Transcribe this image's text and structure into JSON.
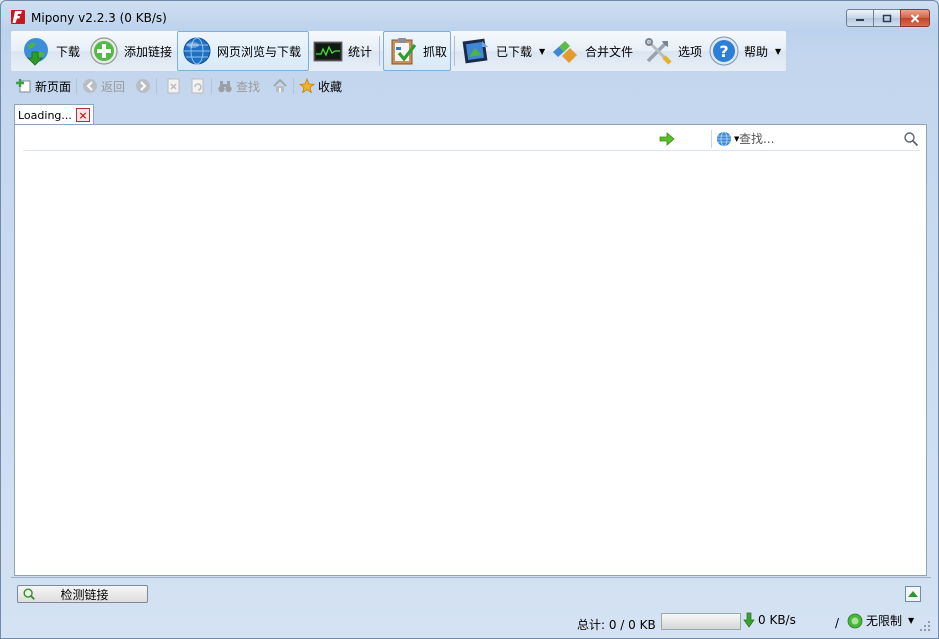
{
  "window": {
    "title": "Mipony v2.2.3 (0 KB/s)"
  },
  "toolbar": {
    "download": "下载",
    "add_link": "添加链接",
    "web_browse": "网页浏览与下载",
    "stats": "统计",
    "capture": "抓取",
    "downloaded": "已下载",
    "merge_files": "合并文件",
    "options": "选项",
    "help": "帮助"
  },
  "browserbar": {
    "new_page": "新页面",
    "back": "返回",
    "find": "查找",
    "favorites": "收藏"
  },
  "tab": {
    "label": "Loading..."
  },
  "address": {
    "value": "",
    "search_placeholder": "查找..."
  },
  "bottom": {
    "detect_links": "检测链接"
  },
  "status": {
    "total": "总计: 0 / 0 KB",
    "progress": 0,
    "speed": "0 KB/s",
    "separator": "/",
    "limit": "无限制"
  },
  "colors": {
    "accent_green": "#3aa32f",
    "close_red": "#c2452a",
    "window_blue": "#bcd2ec"
  }
}
